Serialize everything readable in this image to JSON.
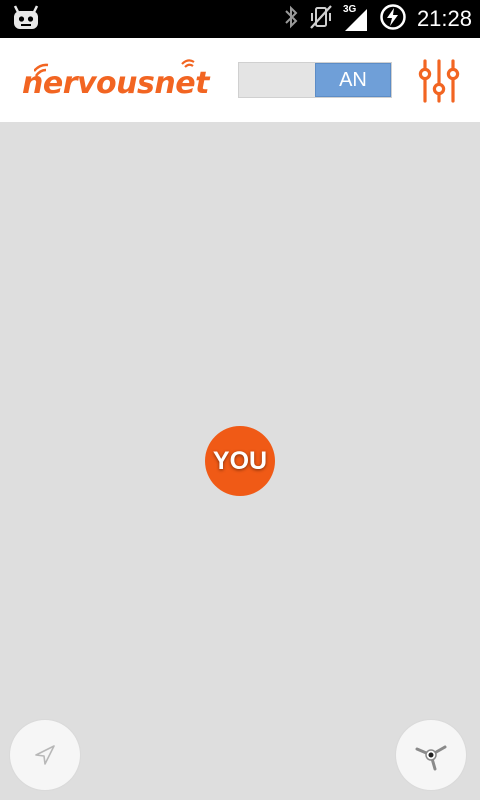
{
  "status_bar": {
    "time": "21:28",
    "network_type": "3G",
    "icons": [
      "cyanogen-bug-icon",
      "bluetooth-icon",
      "vibrate-off-icon",
      "signal-icon",
      "battery-charging-icon"
    ]
  },
  "app_bar": {
    "logo_text": "nervousnet",
    "toggle": {
      "label": "AN",
      "state": "on"
    },
    "settings_icon": "equalizer-icon"
  },
  "map": {
    "marker_label": "YOU",
    "buttons": [
      "navigation-icon",
      "compass-icon"
    ]
  },
  "colors": {
    "brand": "#f26522",
    "marker": "#f05a16",
    "toggle_on": "#6f9fd8",
    "map_background": "#dedede",
    "status_bar": "#000000"
  }
}
